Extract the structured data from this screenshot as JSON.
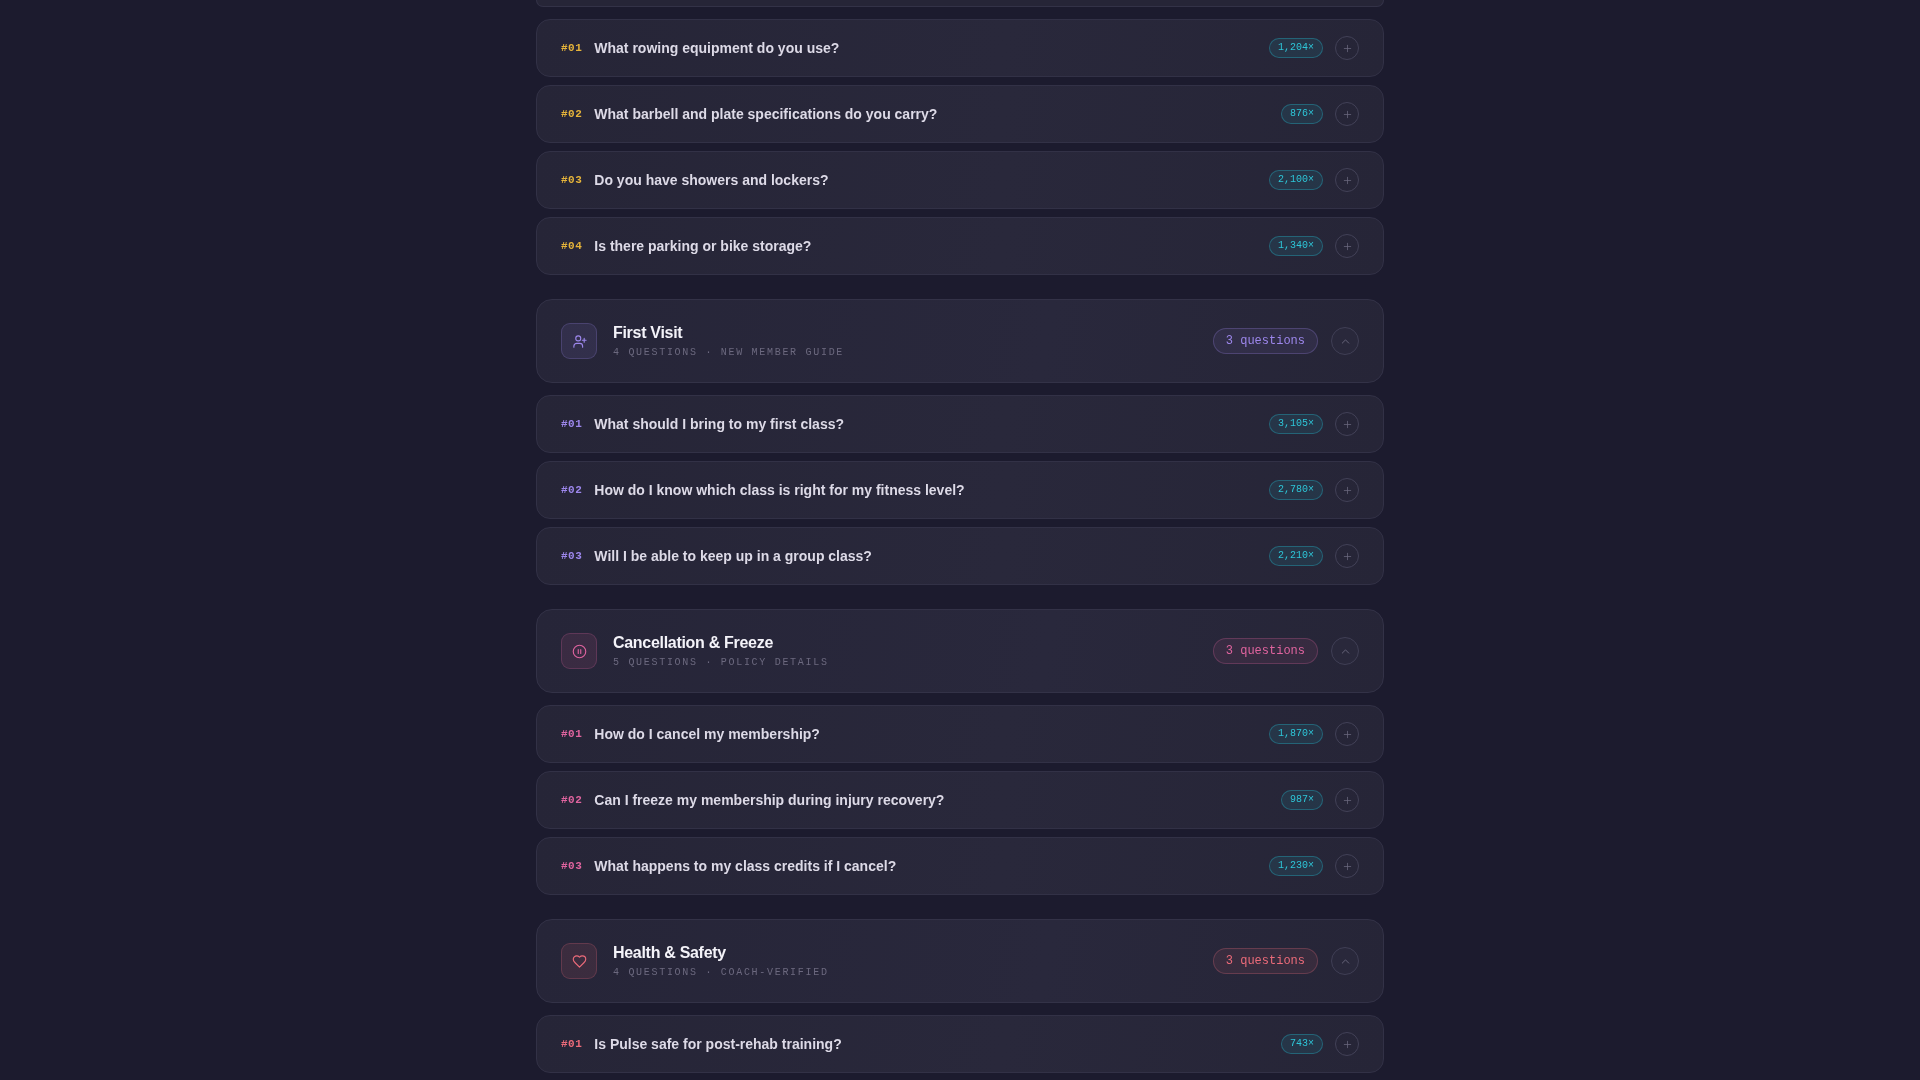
{
  "faq_groups": [
    {
      "color": "#e6b43a",
      "questions": [
        {
          "number": "#01",
          "question": "What rowing equipment do you use?",
          "views": "1,204×",
          "expanded": false
        },
        {
          "number": "#02",
          "question": "What barbell and plate specifications do you carry?",
          "views": "876×",
          "expanded": false
        },
        {
          "number": "#03",
          "question": "Do you have showers and lockers?",
          "views": "2,100×",
          "expanded": false
        },
        {
          "number": "#04",
          "question": "Is there parking or bike storage?",
          "views": "1,340×",
          "expanded": false
        }
      ]
    },
    {
      "title": "First Visit",
      "subtitle": "4 QUESTIONS · NEW MEMBER GUIDE",
      "count_label": "3 questions",
      "expanded": true,
      "color": "#9d87ec",
      "questions": [
        {
          "number": "#01",
          "question": "What should I bring to my first class?",
          "views": "3,105×",
          "expanded": false
        },
        {
          "number": "#02",
          "question": "How do I know which class is right for my fitness level?",
          "views": "2,780×",
          "expanded": false
        },
        {
          "number": "#03",
          "question": "Will I be able to keep up in a group class?",
          "views": "2,210×",
          "expanded": false
        }
      ]
    },
    {
      "title": "Cancellation & Freeze",
      "subtitle": "5 QUESTIONS · POLICY DETAILS",
      "count_label": "3 questions",
      "expanded": true,
      "color": "#e0649f",
      "questions": [
        {
          "number": "#01",
          "question": "How do I cancel my membership?",
          "views": "1,870×",
          "expanded": false
        },
        {
          "number": "#02",
          "question": "Can I freeze my membership during injury recovery?",
          "views": "987×",
          "expanded": false
        },
        {
          "number": "#03",
          "question": "What happens to my class credits if I cancel?",
          "views": "1,230×",
          "expanded": false
        }
      ]
    },
    {
      "title": "Health & Safety",
      "subtitle": "4 QUESTIONS · COACH-VERIFIED",
      "count_label": "3 questions",
      "expanded": true,
      "color": "#ec6b7a",
      "questions": [
        {
          "number": "#01",
          "question": "Is Pulse safe for post-rehab training?",
          "views": "743×",
          "expanded": false
        }
      ]
    }
  ]
}
